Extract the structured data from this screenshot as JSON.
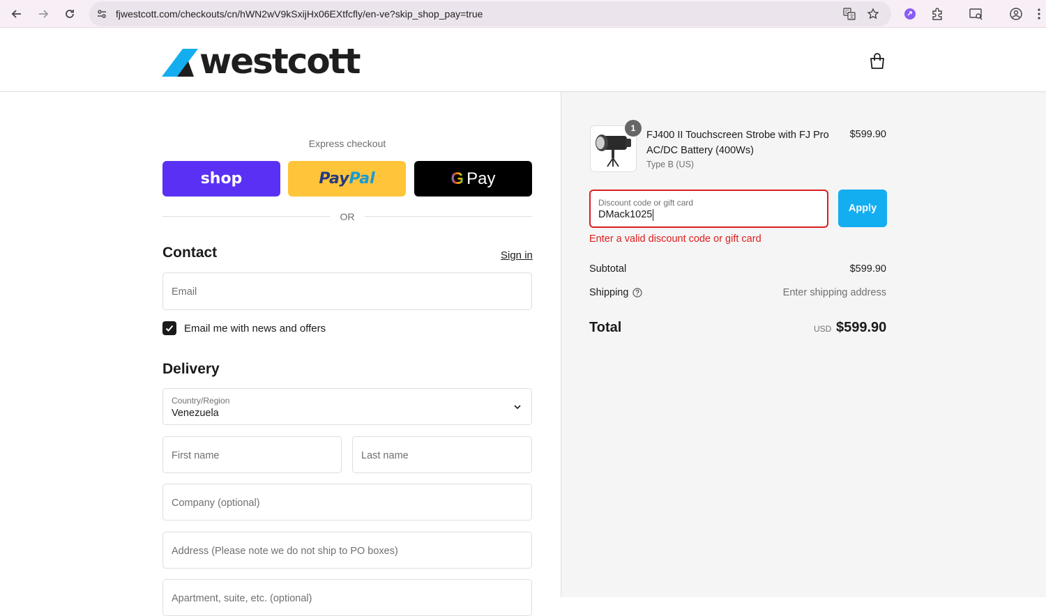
{
  "browser": {
    "url": "fjwestcott.com/checkouts/cn/hWN2wV9kSxijHx06EXtfcfly/en-ve?skip_shop_pay=true",
    "icons": [
      "back-icon",
      "forward-icon",
      "reload-icon",
      "site-info-icon",
      "translate-icon",
      "star-icon",
      "extension-purple-icon",
      "puzzle-icon",
      "media-icon",
      "profile-icon",
      "kebab-menu-icon"
    ]
  },
  "header": {
    "logo_text": "westcott",
    "brand_color": "#13aef0"
  },
  "express": {
    "label": "Express checkout",
    "shop_label": "shop",
    "paypal_part1": "Pay",
    "paypal_part2": "Pal",
    "gpay_g": "G",
    "gpay_label": "Pay",
    "or_label": "OR"
  },
  "contact": {
    "title": "Contact",
    "sign_in": "Sign in",
    "email_placeholder": "Email",
    "newsletter_label": "Email me with news and offers",
    "newsletter_checked": true
  },
  "delivery": {
    "title": "Delivery",
    "country_label": "Country/Region",
    "country_value": "Venezuela",
    "first_name_placeholder": "First name",
    "last_name_placeholder": "Last name",
    "company_placeholder": "Company (optional)",
    "address_placeholder": "Address (Please note we do not ship to PO boxes)",
    "apartment_placeholder": "Apartment, suite, etc. (optional)"
  },
  "summary": {
    "product": {
      "name": "FJ400 II Touchscreen Strobe with FJ Pro AC/DC Battery (400Ws)",
      "variant": "Type B (US)",
      "price": "$599.90",
      "quantity": "1"
    },
    "discount_label": "Discount code or gift card",
    "discount_value": "DMack1025",
    "apply_label": "Apply",
    "error": "Enter a valid discount code or gift card",
    "subtotal_label": "Subtotal",
    "subtotal_value": "$599.90",
    "shipping_label": "Shipping",
    "shipping_value": "Enter shipping address",
    "total_label": "Total",
    "currency": "USD",
    "total_value": "$599.90"
  },
  "colors": {
    "error": "#dd1d1d",
    "apply": "#13aef0",
    "shop": "#5a31f4",
    "paypal": "#ffc439"
  }
}
